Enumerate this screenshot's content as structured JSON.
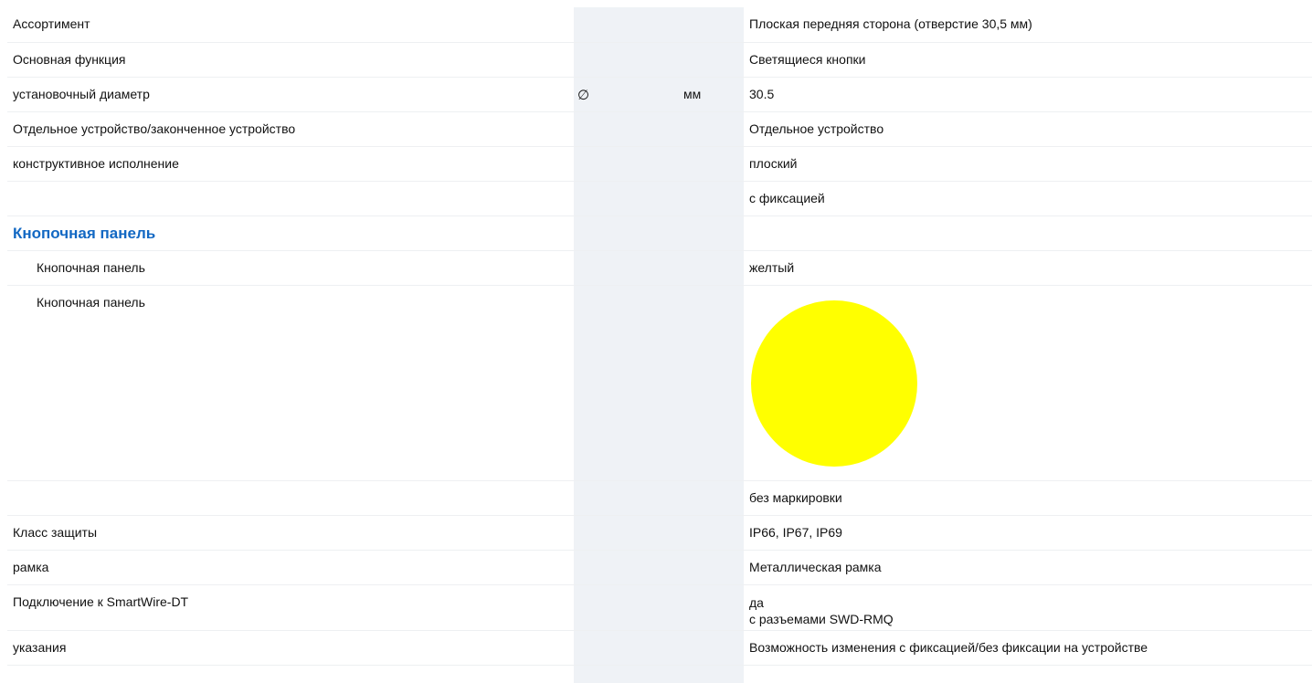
{
  "colors": {
    "accent": "#1268c3",
    "swatch": "#ffff00",
    "grey_column": "#eff2f6"
  },
  "rows": [
    {
      "label": "Ассортимент",
      "value": "Плоская передняя сторона (отверстие 30,5 мм)"
    },
    {
      "label": "Основная функция",
      "value": "Светящиеся кнопки"
    },
    {
      "label": "установочный диаметр",
      "symbol": "∅",
      "unit": "мм",
      "value": "30.5"
    },
    {
      "label": "Отдельное устройство/законченное устройство",
      "value": "Отдельное устройство"
    },
    {
      "label": "конструктивное исполнение",
      "value": "плоский"
    },
    {
      "label": "",
      "value": "с фиксацией"
    }
  ],
  "section": {
    "title": "Кнопочная панель",
    "rows": [
      {
        "label": "Кнопочная панель",
        "value": "желтый"
      },
      {
        "label": "Кнопочная панель",
        "swatch_icon": "yellow-circle-swatch"
      }
    ]
  },
  "rows2": [
    {
      "label": "",
      "value": "без маркировки"
    },
    {
      "label": "Класс защиты",
      "value": "IP66, IP67, IP69"
    },
    {
      "label": "рамка",
      "value": "Металлическая рамка"
    },
    {
      "label": "Подключение к SmartWire-DT",
      "value_lines": [
        "да",
        "с разъемами SWD-RMQ"
      ]
    },
    {
      "label": "указания",
      "value": "Возможность изменения с фиксацией/без фиксации на устройстве"
    }
  ]
}
